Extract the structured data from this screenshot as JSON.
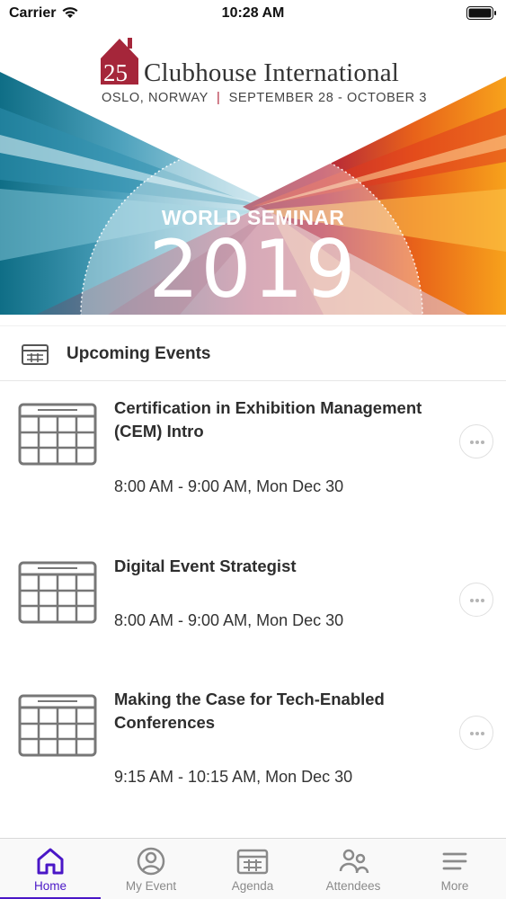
{
  "status": {
    "carrier": "Carrier",
    "time": "10:28 AM"
  },
  "banner": {
    "logo_number": "25",
    "brand": "Clubhouse International",
    "location": "OSLO, NORWAY",
    "dates": "SEPTEMBER 28 - OCTOBER 3",
    "seminar": "WORLD SEMINAR",
    "year": "2019"
  },
  "section": {
    "title": "Upcoming Events",
    "icon": "calendar-icon"
  },
  "events": [
    {
      "title": "Certification in Exhibition Management (CEM) Intro",
      "time": "8:00 AM - 9:00 AM, Mon Dec 30"
    },
    {
      "title": "Digital Event Strategist",
      "time": "8:00 AM - 9:00 AM, Mon Dec 30"
    },
    {
      "title": "Making the Case for Tech-Enabled Conferences",
      "time": "9:15 AM - 10:15 AM, Mon Dec 30"
    }
  ],
  "tabs": [
    {
      "label": "Home",
      "icon": "home-icon",
      "active": true
    },
    {
      "label": "My Event",
      "icon": "user-circle-icon",
      "active": false
    },
    {
      "label": "Agenda",
      "icon": "calendar-icon",
      "active": false
    },
    {
      "label": "Attendees",
      "icon": "people-icon",
      "active": false
    },
    {
      "label": "More",
      "icon": "menu-icon",
      "active": false
    }
  ],
  "colors": {
    "accent": "#4a17c7",
    "brand_red": "#b0263a"
  }
}
